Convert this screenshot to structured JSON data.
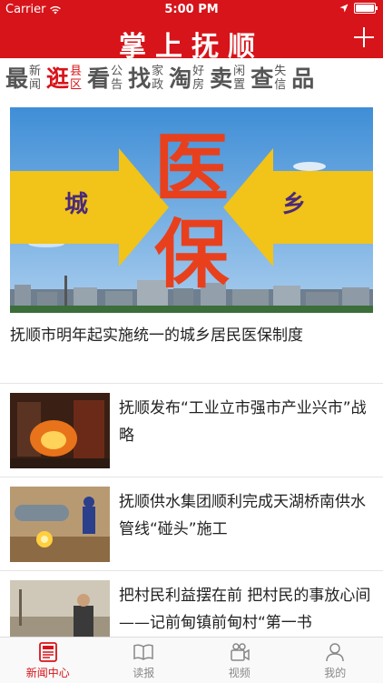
{
  "status": {
    "carrier": "Carrier",
    "time": "5:00 PM"
  },
  "header": {
    "title": "掌上抚顺"
  },
  "channels": [
    {
      "big": "最",
      "small": [
        "新",
        "闻"
      ]
    },
    {
      "big": "逛",
      "small": [
        "县",
        "区"
      ]
    },
    {
      "big": "看",
      "small": [
        "公",
        "告"
      ]
    },
    {
      "big": "找",
      "small": [
        "家",
        "政"
      ]
    },
    {
      "big": "淘",
      "small": [
        "好",
        "房"
      ]
    },
    {
      "big": "卖",
      "small": [
        "闲",
        "置"
      ]
    },
    {
      "big": "查",
      "small": [
        "失",
        "信"
      ]
    },
    {
      "big": "品",
      "small": [
        "",
        ""
      ]
    }
  ],
  "hero": {
    "image_text": {
      "big_top": "医",
      "big_bottom": "保",
      "left": "城",
      "right": "乡"
    },
    "caption": "抚顺市明年起实施统一的城乡居民医保制度"
  },
  "news": [
    {
      "title": "抚顺发布“工业立市强市产业兴市”战略"
    },
    {
      "title": "抚顺供水集团顺利完成天湖桥南供水管线“碰头”施工"
    },
    {
      "title": "把村民利益摆在前 把村民的事放心间——记前甸镇前甸村“第一书"
    }
  ],
  "tabs": [
    {
      "label": "新闻中心",
      "icon": "newspaper-icon"
    },
    {
      "label": "读报",
      "icon": "open-book-icon"
    },
    {
      "label": "视频",
      "icon": "video-camera-icon"
    },
    {
      "label": "我的",
      "icon": "person-icon"
    }
  ],
  "colors": {
    "brand_red": "#d7141a",
    "active_channel": "#d7141a",
    "inactive_channel": "#555555"
  }
}
